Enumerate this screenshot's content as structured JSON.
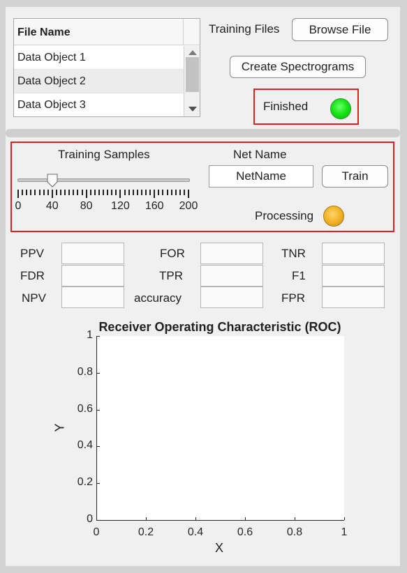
{
  "file_table": {
    "header": "File Name",
    "rows": [
      "Data Object 1",
      "Data Object 2",
      "Data Object 3"
    ]
  },
  "top_panel": {
    "training_files_label": "Training Files",
    "browse_button": "Browse File",
    "create_button": "Create Spectrograms",
    "finished_label": "Finished",
    "finished_lamp_color": "#19e619"
  },
  "train_panel": {
    "training_samples_label": "Training Samples",
    "slider": {
      "value": 40,
      "min": 0,
      "max": 200,
      "tick_labels": [
        "0",
        "40",
        "80",
        "120",
        "160",
        "200"
      ]
    },
    "net_name_label": "Net Name",
    "net_name_value": "NetName",
    "train_button": "Train",
    "processing_label": "Processing",
    "processing_lamp_color": "#f0b020"
  },
  "metrics": {
    "ppv": "PPV",
    "for": "FOR",
    "tnr": "TNR",
    "fdr": "FDR",
    "tpr": "TPR",
    "f1": "F1",
    "npv": "NPV",
    "accuracy": "accuracy",
    "fpr": "FPR"
  },
  "highlight_color": "#e02020",
  "chart_data": {
    "type": "line",
    "title": "Receiver Operating Characteristic (ROC)",
    "xlabel": "X",
    "ylabel": "Y",
    "xlim": [
      0,
      1
    ],
    "ylim": [
      0,
      1
    ],
    "xticks": [
      "0",
      "0.2",
      "0.4",
      "0.6",
      "0.8",
      "1"
    ],
    "yticks": [
      "0",
      "0.2",
      "0.4",
      "0.6",
      "0.8",
      "1"
    ],
    "series": [],
    "grid": false
  }
}
